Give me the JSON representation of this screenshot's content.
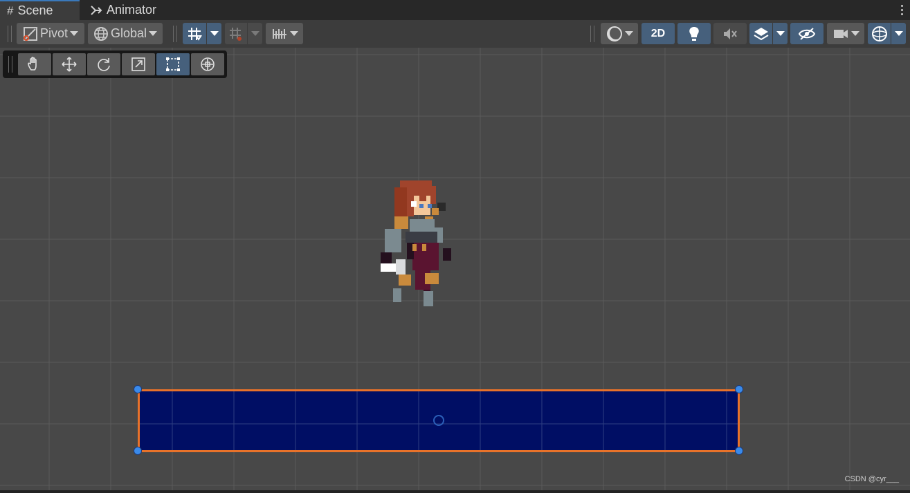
{
  "tabs": [
    {
      "label": "Scene",
      "icon": "grid-icon",
      "active": true
    },
    {
      "label": "Animator",
      "icon": "animator-icon",
      "active": false
    }
  ],
  "toolbar": {
    "pivot_label": "Pivot",
    "global_label": "Global",
    "mode_2d_label": "2D"
  },
  "scene": {
    "selected_object": "platform-rectangle",
    "fill_color": "#000e64",
    "outline_color": "#e8722a"
  },
  "watermark": "CSDN @cyr___",
  "colors": {
    "accent": "#46607c",
    "handle": "#3a8aea"
  }
}
